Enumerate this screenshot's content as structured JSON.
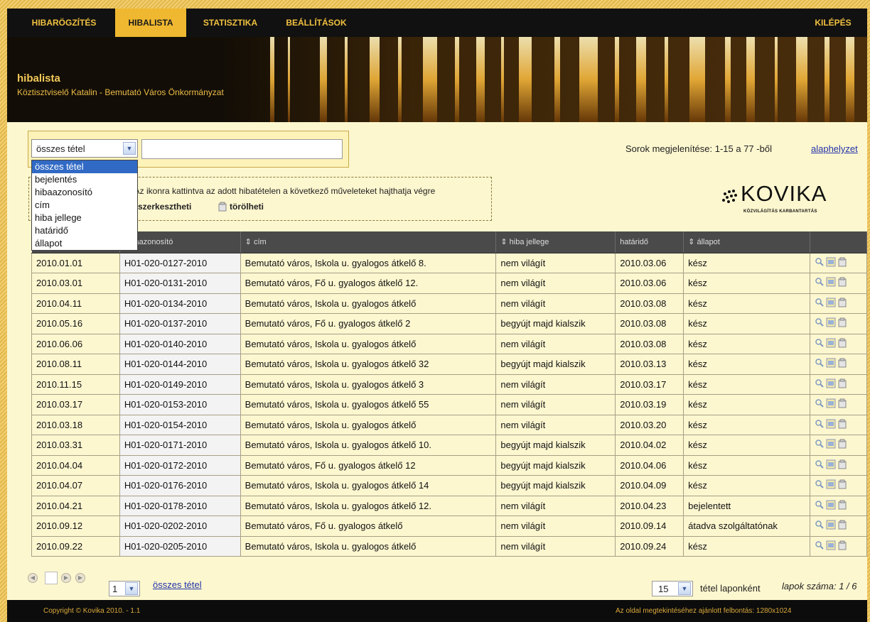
{
  "nav": {
    "items": [
      "HIBARÖGZÍTÉS",
      "HIBALISTA",
      "STATISZTIKA",
      "BEÁLLÍTÁSOK"
    ],
    "active": "HIBALISTA",
    "logout": "KILÉPÉS"
  },
  "banner": {
    "title": "hibalista",
    "subtitle": "Köztisztviselő Katalin - Bemutató Város Önkormányzat"
  },
  "filter": {
    "selected": "összes tétel",
    "options": [
      "összes tétel",
      "bejelentés",
      "hibaazonosító",
      "cím",
      "hiba jellege",
      "határidő",
      "állapot"
    ],
    "search_value": ""
  },
  "info": {
    "text": "se. Az ikonra kattintva az adott hibatételen a következő műveleteket hajthatja végre",
    "edit": "szerkesztheti",
    "delete": "törölheti"
  },
  "rows_info": "Sorok megjelenítése: 1-15 a 77 -ből",
  "reset_link": "alaphelyzet",
  "logo": {
    "name": "KOVIKA",
    "tagline": "KÖZVILÁGÍTÁS KARBANTARTÁS"
  },
  "table": {
    "headers": [
      "",
      "hibaazonosító",
      "⇕ cím",
      "⇕ hiba jellege",
      "határidő",
      "⇕ állapot",
      ""
    ],
    "rows": [
      [
        "2010.01.01",
        "H01-020-0127-2010",
        "Bemutató város, Iskola u. gyalogos átkelő 8.",
        "nem világít",
        "2010.03.06",
        "kész"
      ],
      [
        "2010.03.01",
        "H01-020-0131-2010",
        "Bemutató város, Fő u. gyalogos átkelő 12.",
        "nem világít",
        "2010.03.06",
        "kész"
      ],
      [
        "2010.04.11",
        "H01-020-0134-2010",
        "Bemutató város, Iskola u. gyalogos átkelő",
        "nem világít",
        "2010.03.08",
        "kész"
      ],
      [
        "2010.05.16",
        "H01-020-0137-2010",
        "Bemutató város, Fő u. gyalogos átkelő 2",
        "begyújt majd kialszik",
        "2010.03.08",
        "kész"
      ],
      [
        "2010.06.06",
        "H01-020-0140-2010",
        "Bemutató város, Iskola u. gyalogos átkelő",
        "nem világít",
        "2010.03.08",
        "kész"
      ],
      [
        "2010.08.11",
        "H01-020-0144-2010",
        "Bemutató város, Iskola u. gyalogos átkelő 32",
        "begyújt majd kialszik",
        "2010.03.13",
        "kész"
      ],
      [
        "2010.11.15",
        "H01-020-0149-2010",
        "Bemutató város, Iskola u. gyalogos átkelő 3",
        "nem világít",
        "2010.03.17",
        "kész"
      ],
      [
        "2010.03.17",
        "H01-020-0153-2010",
        "Bemutató város, Iskola u. gyalogos átkelő 55",
        "nem világít",
        "2010.03.19",
        "kész"
      ],
      [
        "2010.03.18",
        "H01-020-0154-2010",
        "Bemutató város, Iskola u. gyalogos átkelő",
        "nem világít",
        "2010.03.20",
        "kész"
      ],
      [
        "2010.03.31",
        "H01-020-0171-2010",
        "Bemutató város, Iskola u. gyalogos átkelő 10.",
        "begyújt majd kialszik",
        "2010.04.02",
        "kész"
      ],
      [
        "2010.04.04",
        "H01-020-0172-2010",
        "Bemutató város, Fő u. gyalogos átkelő 12",
        "begyújt majd kialszik",
        "2010.04.06",
        "kész"
      ],
      [
        "2010.04.07",
        "H01-020-0176-2010",
        "Bemutató város, Iskola u. gyalogos átkelő 14",
        "begyújt majd kialszik",
        "2010.04.09",
        "kész"
      ],
      [
        "2010.04.21",
        "H01-020-0178-2010",
        "Bemutató város, Iskola u. gyalogos átkelő 12.",
        "nem világít",
        "2010.04.23",
        "bejelentett"
      ],
      [
        "2010.09.12",
        "H01-020-0202-2010",
        "Bemutató város, Fő u. gyalogos átkelő",
        "nem világít",
        "2010.09.14",
        "átadva szolgáltatónak"
      ],
      [
        "2010.09.22",
        "H01-020-0205-2010",
        "Bemutató város, Iskola u. gyalogos átkelő",
        "nem világít",
        "2010.09.24",
        "kész"
      ]
    ]
  },
  "pager": {
    "page": "1",
    "all_link": "összes tétel",
    "per_page": "15",
    "per_page_label": "tétel laponként",
    "page_count": "lapok száma: 1 / 6"
  },
  "footer": {
    "copyright": "Copyright © Kovika 2010. - 1.1",
    "resolution": "Az oldal megtekintéséhez ajánlott felbontás: 1280x1024"
  },
  "colors": {
    "accent": "#f0b830",
    "background": "#fdf7cf",
    "header_bg": "#4a4a4a"
  }
}
